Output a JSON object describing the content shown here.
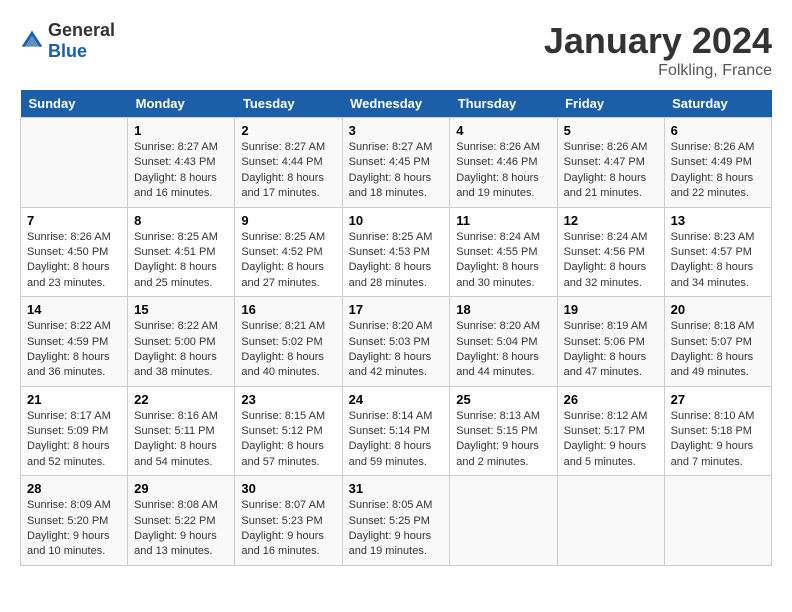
{
  "header": {
    "logo_general": "General",
    "logo_blue": "Blue",
    "title": "January 2024",
    "subtitle": "Folkling, France"
  },
  "days_of_week": [
    "Sunday",
    "Monday",
    "Tuesday",
    "Wednesday",
    "Thursday",
    "Friday",
    "Saturday"
  ],
  "weeks": [
    [
      {
        "day": "",
        "info": ""
      },
      {
        "day": "1",
        "info": "Sunrise: 8:27 AM\nSunset: 4:43 PM\nDaylight: 8 hours\nand 16 minutes."
      },
      {
        "day": "2",
        "info": "Sunrise: 8:27 AM\nSunset: 4:44 PM\nDaylight: 8 hours\nand 17 minutes."
      },
      {
        "day": "3",
        "info": "Sunrise: 8:27 AM\nSunset: 4:45 PM\nDaylight: 8 hours\nand 18 minutes."
      },
      {
        "day": "4",
        "info": "Sunrise: 8:26 AM\nSunset: 4:46 PM\nDaylight: 8 hours\nand 19 minutes."
      },
      {
        "day": "5",
        "info": "Sunrise: 8:26 AM\nSunset: 4:47 PM\nDaylight: 8 hours\nand 21 minutes."
      },
      {
        "day": "6",
        "info": "Sunrise: 8:26 AM\nSunset: 4:49 PM\nDaylight: 8 hours\nand 22 minutes."
      }
    ],
    [
      {
        "day": "7",
        "info": "Sunrise: 8:26 AM\nSunset: 4:50 PM\nDaylight: 8 hours\nand 23 minutes."
      },
      {
        "day": "8",
        "info": "Sunrise: 8:25 AM\nSunset: 4:51 PM\nDaylight: 8 hours\nand 25 minutes."
      },
      {
        "day": "9",
        "info": "Sunrise: 8:25 AM\nSunset: 4:52 PM\nDaylight: 8 hours\nand 27 minutes."
      },
      {
        "day": "10",
        "info": "Sunrise: 8:25 AM\nSunset: 4:53 PM\nDaylight: 8 hours\nand 28 minutes."
      },
      {
        "day": "11",
        "info": "Sunrise: 8:24 AM\nSunset: 4:55 PM\nDaylight: 8 hours\nand 30 minutes."
      },
      {
        "day": "12",
        "info": "Sunrise: 8:24 AM\nSunset: 4:56 PM\nDaylight: 8 hours\nand 32 minutes."
      },
      {
        "day": "13",
        "info": "Sunrise: 8:23 AM\nSunset: 4:57 PM\nDaylight: 8 hours\nand 34 minutes."
      }
    ],
    [
      {
        "day": "14",
        "info": "Sunrise: 8:22 AM\nSunset: 4:59 PM\nDaylight: 8 hours\nand 36 minutes."
      },
      {
        "day": "15",
        "info": "Sunrise: 8:22 AM\nSunset: 5:00 PM\nDaylight: 8 hours\nand 38 minutes."
      },
      {
        "day": "16",
        "info": "Sunrise: 8:21 AM\nSunset: 5:02 PM\nDaylight: 8 hours\nand 40 minutes."
      },
      {
        "day": "17",
        "info": "Sunrise: 8:20 AM\nSunset: 5:03 PM\nDaylight: 8 hours\nand 42 minutes."
      },
      {
        "day": "18",
        "info": "Sunrise: 8:20 AM\nSunset: 5:04 PM\nDaylight: 8 hours\nand 44 minutes."
      },
      {
        "day": "19",
        "info": "Sunrise: 8:19 AM\nSunset: 5:06 PM\nDaylight: 8 hours\nand 47 minutes."
      },
      {
        "day": "20",
        "info": "Sunrise: 8:18 AM\nSunset: 5:07 PM\nDaylight: 8 hours\nand 49 minutes."
      }
    ],
    [
      {
        "day": "21",
        "info": "Sunrise: 8:17 AM\nSunset: 5:09 PM\nDaylight: 8 hours\nand 52 minutes."
      },
      {
        "day": "22",
        "info": "Sunrise: 8:16 AM\nSunset: 5:11 PM\nDaylight: 8 hours\nand 54 minutes."
      },
      {
        "day": "23",
        "info": "Sunrise: 8:15 AM\nSunset: 5:12 PM\nDaylight: 8 hours\nand 57 minutes."
      },
      {
        "day": "24",
        "info": "Sunrise: 8:14 AM\nSunset: 5:14 PM\nDaylight: 8 hours\nand 59 minutes."
      },
      {
        "day": "25",
        "info": "Sunrise: 8:13 AM\nSunset: 5:15 PM\nDaylight: 9 hours\nand 2 minutes."
      },
      {
        "day": "26",
        "info": "Sunrise: 8:12 AM\nSunset: 5:17 PM\nDaylight: 9 hours\nand 5 minutes."
      },
      {
        "day": "27",
        "info": "Sunrise: 8:10 AM\nSunset: 5:18 PM\nDaylight: 9 hours\nand 7 minutes."
      }
    ],
    [
      {
        "day": "28",
        "info": "Sunrise: 8:09 AM\nSunset: 5:20 PM\nDaylight: 9 hours\nand 10 minutes."
      },
      {
        "day": "29",
        "info": "Sunrise: 8:08 AM\nSunset: 5:22 PM\nDaylight: 9 hours\nand 13 minutes."
      },
      {
        "day": "30",
        "info": "Sunrise: 8:07 AM\nSunset: 5:23 PM\nDaylight: 9 hours\nand 16 minutes."
      },
      {
        "day": "31",
        "info": "Sunrise: 8:05 AM\nSunset: 5:25 PM\nDaylight: 9 hours\nand 19 minutes."
      },
      {
        "day": "",
        "info": ""
      },
      {
        "day": "",
        "info": ""
      },
      {
        "day": "",
        "info": ""
      }
    ]
  ]
}
